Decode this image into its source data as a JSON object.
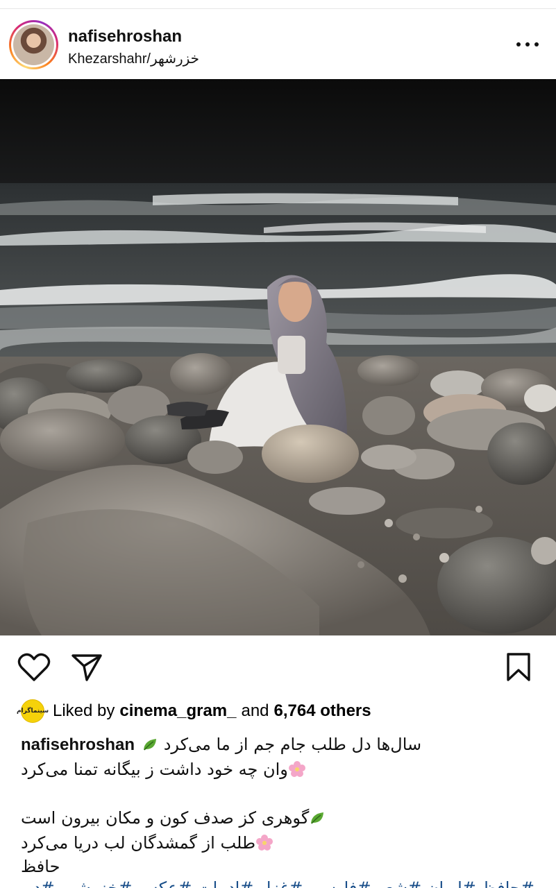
{
  "header": {
    "username": "nafisehroshan",
    "location": "Khezarshahr/خزرشهر",
    "more_icon": "more-horizontal-icon"
  },
  "actions": {
    "like_icon": "heart-icon",
    "share_icon": "send-icon",
    "save_icon": "bookmark-icon"
  },
  "likes": {
    "prefix": "Liked by",
    "liker": "cinema_gram_",
    "connector": "and",
    "others": "6,764 others",
    "liker_avatar_text": "سینماگرام"
  },
  "caption": {
    "username": "nafisehroshan",
    "lines": [
      "سال‌ها دل طلب جام جم از ما می‌کرد",
      "وان چه خود داشت ز بیگانه تمنا می‌کرد",
      "گوهری کز صدف کون و مکان بیرون است",
      "طلب از گمشدگان لب دریا می‌کرد",
      "حافظ"
    ],
    "hashtags": "#حافظ #ایران #شعر #فارسی #غزل #ادبیات #عکس #خزرشهر #دریا"
  },
  "colors": {
    "hashtag": "#1a4f8a",
    "ring_start": "#feda75",
    "ring_end": "#962fbf",
    "liker_avatar_bg": "#f5d20a"
  }
}
